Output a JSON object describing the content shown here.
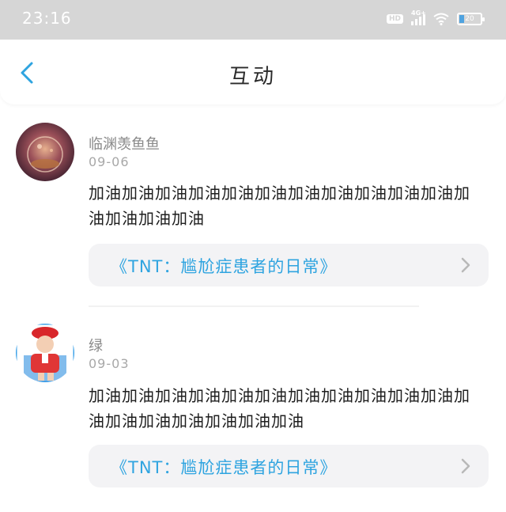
{
  "status_bar": {
    "time": "23:16",
    "hd_label": "HD",
    "network_label": "4G+",
    "battery_level": "20"
  },
  "header": {
    "title": "互动",
    "back_icon": "chevron-left-icon"
  },
  "comments": [
    {
      "username": "临渊羡鱼鱼",
      "date": "09-06",
      "message": "加油加油加油加油加油加油加油加油加油加油加油加油加油加油加油",
      "work_title": "《TNT：尴尬症患者的日常》"
    },
    {
      "username": "绿",
      "date": "09-03",
      "message": "加油加油加油加油加油加油加油加油加油加油加油加油加油加油加油加油加油加油",
      "work_title": "《TNT：尴尬症患者的日常》"
    }
  ],
  "colors": {
    "accent": "#2fa4e0",
    "status_bar_bg": "#d6d6d6",
    "card_bg": "#f3f3f5"
  }
}
